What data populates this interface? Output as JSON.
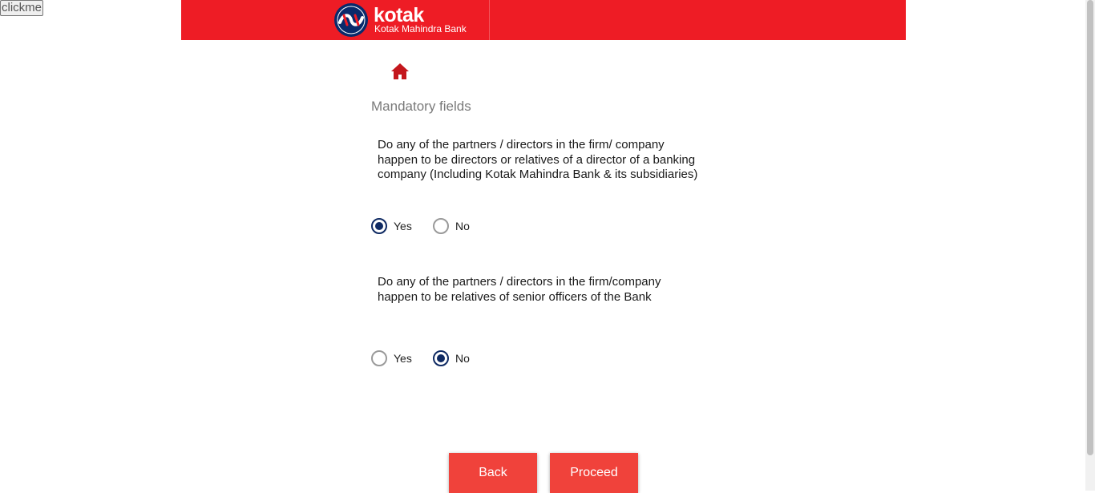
{
  "top_button": {
    "label": "clickme"
  },
  "header": {
    "brand_name": "kotak",
    "brand_subtitle": "Kotak Mahindra Bank",
    "brand_color": "#ee1c25"
  },
  "nav": {
    "home_icon": "home-icon"
  },
  "form": {
    "heading": "Mandatory fields",
    "questions": [
      {
        "text": "Do any of the partners / directors in the firm/ company happen to be directors or relatives of a director of a banking company (Including Kotak Mahindra Bank & its subsidiaries)",
        "options": [
          "Yes",
          "No"
        ],
        "selected": "Yes"
      },
      {
        "text": "Do any of the partners / directors in the firm/company happen to be relatives of senior officers of the Bank",
        "options": [
          "Yes",
          "No"
        ],
        "selected": "No"
      }
    ]
  },
  "actions": {
    "back_label": "Back",
    "proceed_label": "Proceed",
    "button_color": "#f0423b"
  },
  "colors": {
    "radio_selected": "#0f2a63",
    "home_icon": "#c4161c"
  }
}
